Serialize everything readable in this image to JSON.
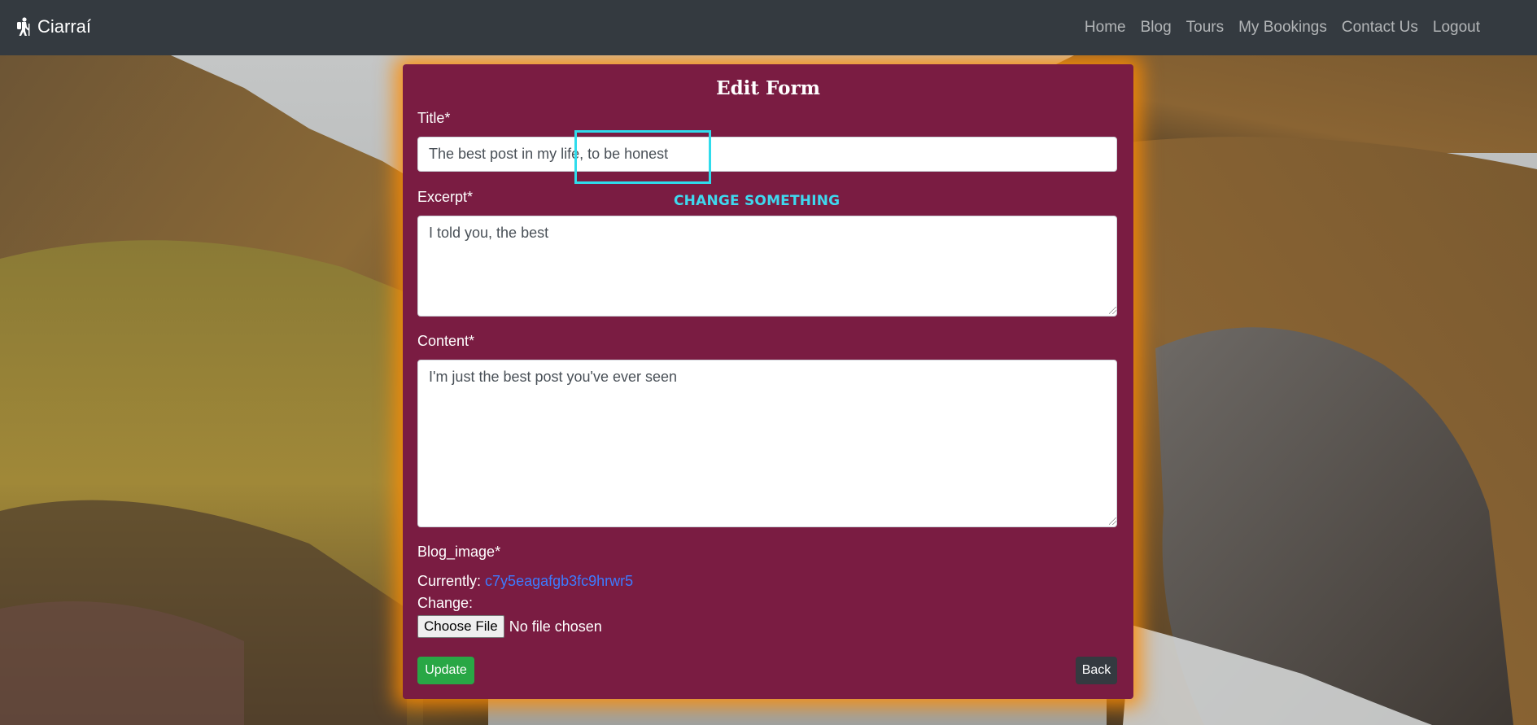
{
  "navbar": {
    "brand": "Ciarraí",
    "links": [
      "Home",
      "Blog",
      "Tours",
      "My Bookings",
      "Contact Us",
      "Logout"
    ]
  },
  "form": {
    "heading": "Edit Form",
    "title_label": "Title*",
    "title_value": "The best post in my life, to be honest",
    "excerpt_label": "Excerpt*",
    "excerpt_value": "I told you, the best",
    "content_label": "Content*",
    "content_value": "I'm just the best post you've ever seen",
    "image_label": "Blog_image*",
    "currently_label": "Currently:",
    "currently_link": "c7y5eagafgb3fc9hrwr5",
    "change_label": "Change:",
    "choose_file": "Choose File",
    "no_file": "No file chosen",
    "update_button": "Update",
    "back_button": "Back"
  },
  "annotation": {
    "text": "CHANGE SOMETHING",
    "color": "#2fdcec"
  },
  "colors": {
    "navbar": "#343a40",
    "card": "#7a1c42",
    "glow": "#ff8c00",
    "update": "#28a745",
    "back": "#343a40",
    "link": "#3d7bff"
  }
}
